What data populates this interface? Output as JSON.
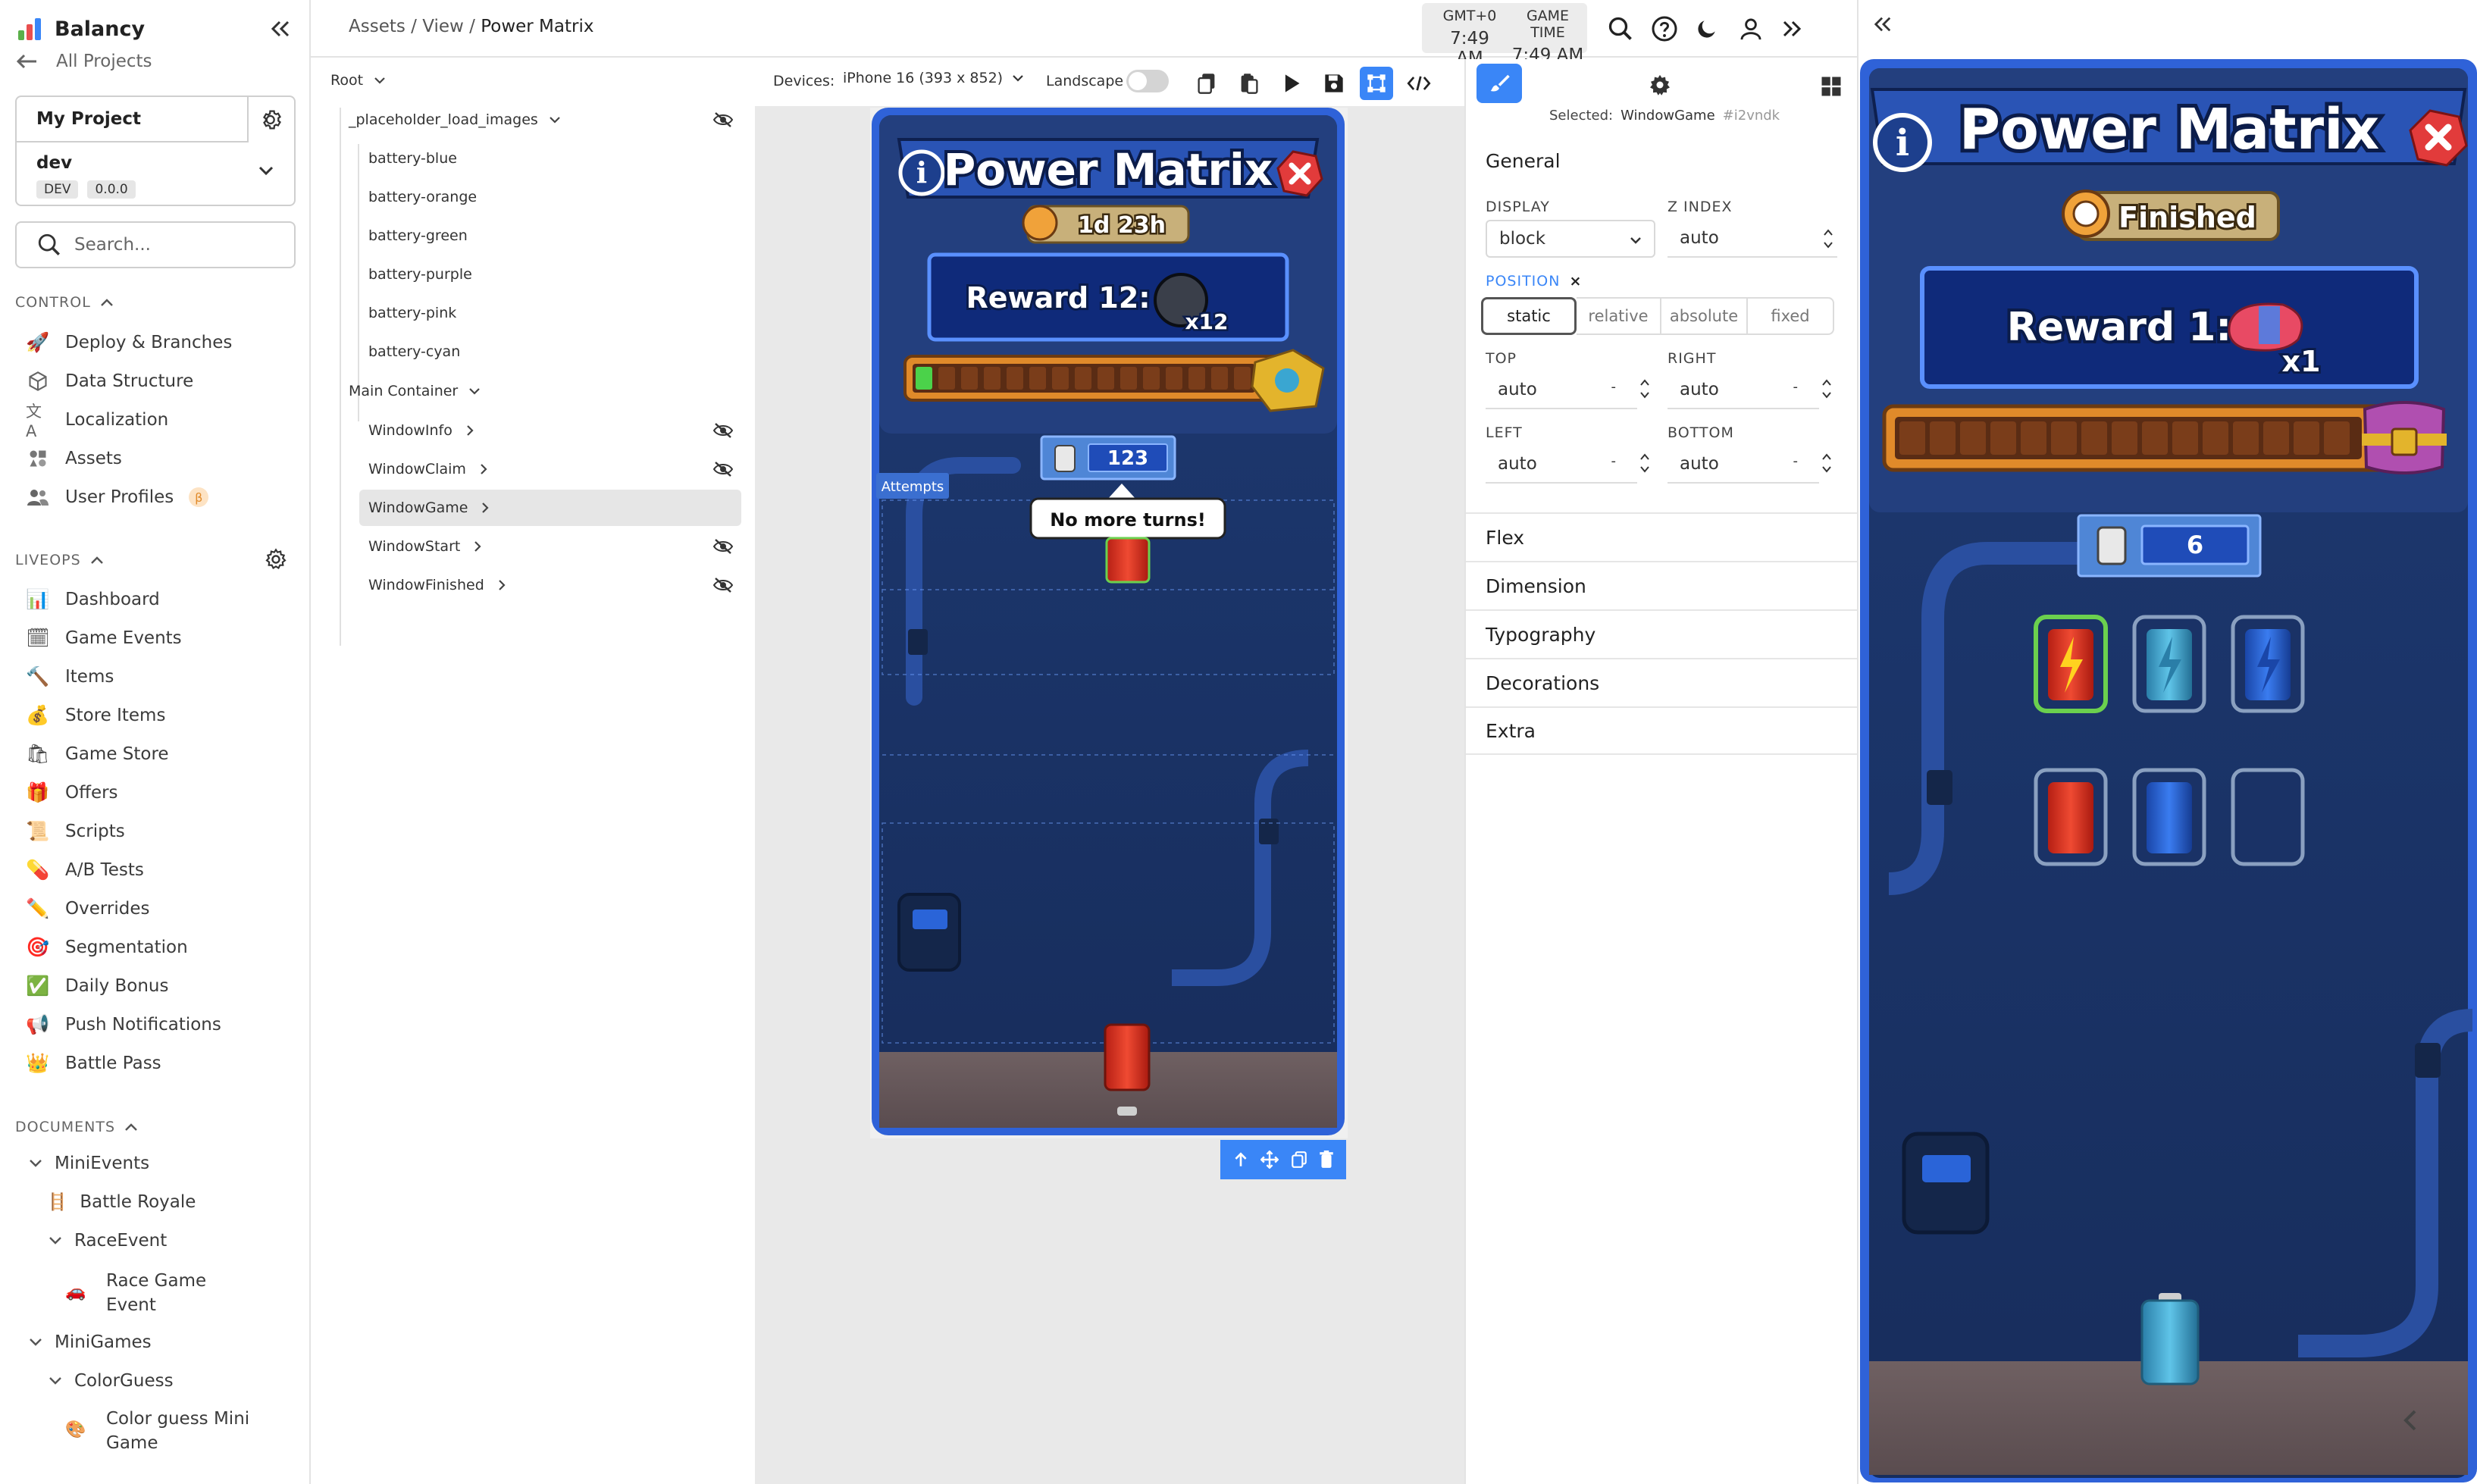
{
  "app": {
    "name": "Balancy",
    "all_projects": "All Projects"
  },
  "project": {
    "name": "My Project",
    "env": "dev",
    "env_tag": "DEV",
    "version": "0.0.0"
  },
  "search": {
    "placeholder": "Search..."
  },
  "sections": {
    "control": "CONTROL",
    "liveops": "LIVEOPS",
    "documents": "DOCUMENTS"
  },
  "control_items": [
    "Deploy & Branches",
    "Data Structure",
    "Localization",
    "Assets",
    "User Profiles"
  ],
  "beta_badge": "β",
  "liveops_items": [
    "Dashboard",
    "Game Events",
    "Items",
    "Store Items",
    "Game Store",
    "Offers",
    "Scripts",
    "A/B Tests",
    "Overrides",
    "Segmentation",
    "Daily Bonus",
    "Push Notifications",
    "Battle Pass"
  ],
  "documents": {
    "minievents": "MiniEvents",
    "battle_royale": "Battle Royale",
    "race_event": "RaceEvent",
    "race_game_event_1": "Race Game",
    "race_game_event_2": "Event",
    "minigames": "MiniGames",
    "color_guess": "ColorGuess",
    "color_guess_mini_1": "Color guess Mini",
    "color_guess_mini_2": "Game"
  },
  "breadcrumb": {
    "part1": "Assets",
    "sep": "/",
    "part2": "View",
    "current": "Power Matrix"
  },
  "clock": {
    "tz_label": "GMT+0",
    "tz_time": "7:49 AM",
    "game_label": "GAME TIME",
    "game_time": "7:49 AM"
  },
  "tree": {
    "root": "Root",
    "placeholder": "_placeholder_load_images",
    "batteries": [
      "battery-blue",
      "battery-orange",
      "battery-green",
      "battery-purple",
      "battery-pink",
      "battery-cyan"
    ],
    "main_container": "Main Container",
    "windows": [
      "WindowInfo",
      "WindowClaim",
      "WindowGame",
      "WindowStart",
      "WindowFinished"
    ]
  },
  "toolbar": {
    "devices_label": "Devices:",
    "device": "iPhone 16 (393 x 852)",
    "landscape_label": "Landscape"
  },
  "game_left": {
    "title": "Power Matrix",
    "timer": "1d 23h",
    "reward_label": "Reward 12:",
    "reward_mult": "x12",
    "attempts_tag": "Attempts",
    "attempts_count": "123",
    "tooltip": "No more turns!"
  },
  "props": {
    "selected_label": "Selected:",
    "selected_value": "WindowGame",
    "selected_id": "#i2vndk",
    "general": "General",
    "display_label": "DISPLAY",
    "display_value": "block",
    "zindex_label": "Z INDEX",
    "zindex_value": "auto",
    "position_label": "POSITION",
    "position_clear": "×",
    "position_options": [
      "static",
      "relative",
      "absolute",
      "fixed"
    ],
    "top_label": "TOP",
    "top_value": "auto",
    "right_label": "RIGHT",
    "right_value": "auto",
    "left_label": "LEFT",
    "left_value": "auto",
    "bottom_label": "BOTTOM",
    "bottom_value": "auto",
    "spin_minus": "-",
    "sections": [
      "Flex",
      "Dimension",
      "Typography",
      "Decorations",
      "Extra"
    ]
  },
  "game_right": {
    "title": "Power Matrix",
    "status": "Finished",
    "reward_label": "Reward 1:",
    "reward_mult": "x1",
    "attempts_count": "6"
  },
  "colors": {
    "accent": "#3a86f7",
    "game_navy": "#1b3468",
    "game_frame": "#2f62d8",
    "battery_red": "#e53b2c",
    "battery_blue": "#2a64d8",
    "battery_cyan": "#3aa6d1"
  }
}
